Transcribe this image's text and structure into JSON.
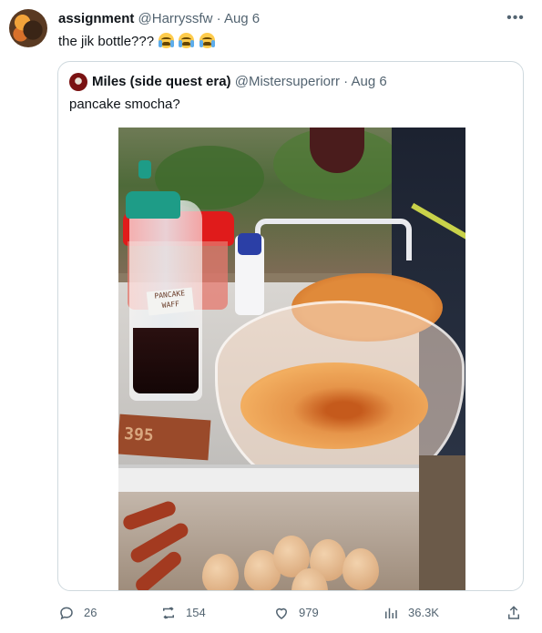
{
  "tweet": {
    "author_name": "assignment",
    "author_handle": "@Harryssfw",
    "separator": "·",
    "date": "Aug 6",
    "text": "the jik bottle???"
  },
  "quoted": {
    "author_name": "Miles (side quest era)",
    "author_handle": "@Mistersuperiorr",
    "separator": "·",
    "date": "Aug 6",
    "text": "pancake smocha?",
    "photo_label_line1": "PANCAKE",
    "photo_label_line2": "WAFF",
    "photo_price": "395"
  },
  "actions": {
    "replies": "26",
    "retweets": "154",
    "likes": "979",
    "views": "36.3K"
  },
  "icons": [
    "more-icon",
    "reply-icon",
    "retweet-icon",
    "like-icon",
    "views-icon",
    "share-icon",
    "loudly-crying-face-emoji"
  ],
  "colors": {
    "text": "#0f1419",
    "muted": "#536471",
    "border": "#cfd9de"
  }
}
